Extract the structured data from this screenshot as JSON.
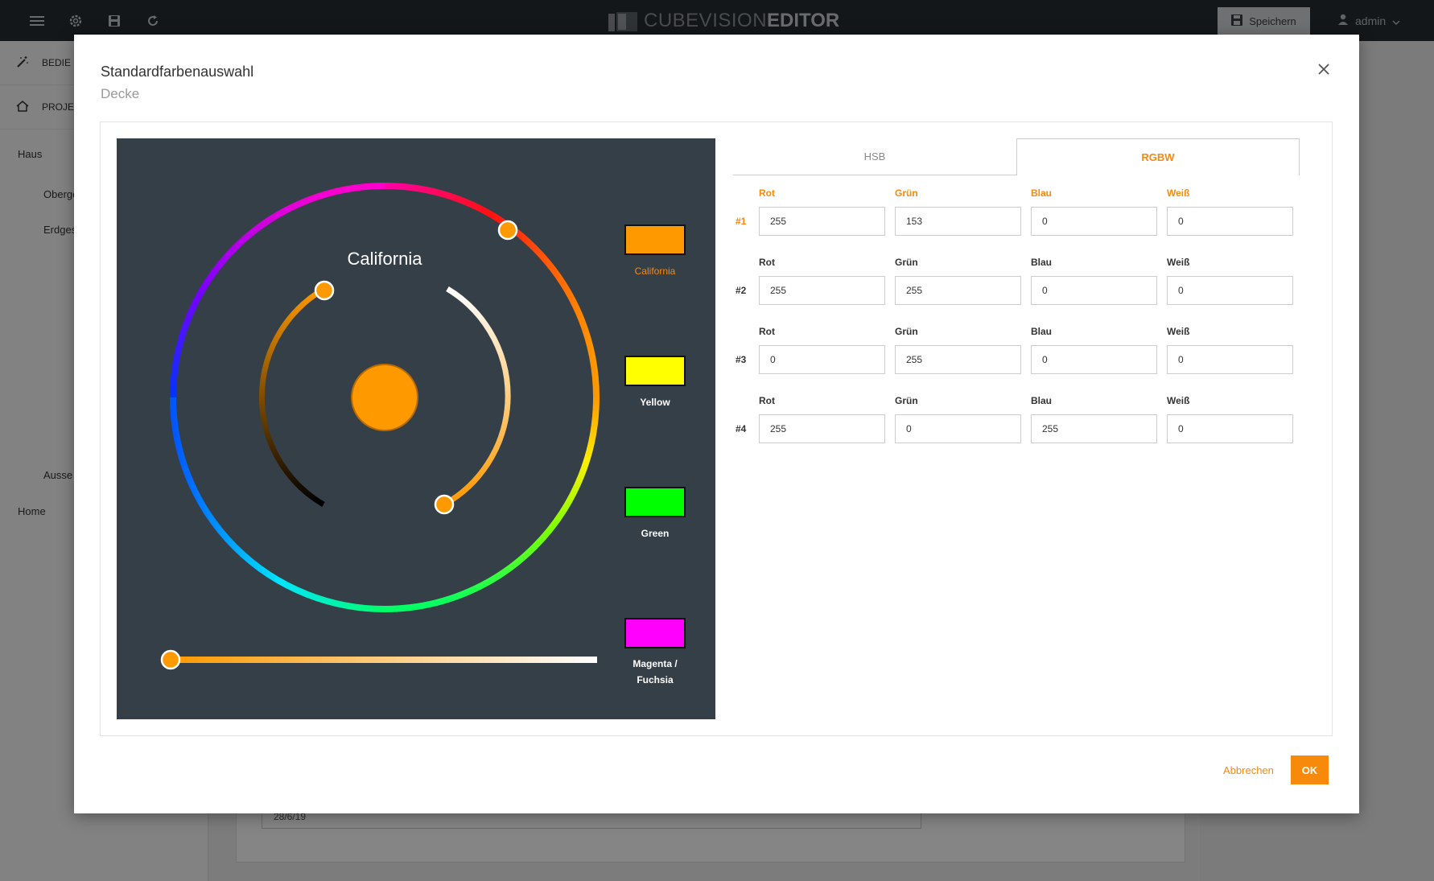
{
  "app": {
    "title_part1": "CUBEVISION",
    "title_part2": "EDITOR",
    "save_label": "Speichern",
    "user": "admin"
  },
  "sidebar": {
    "nav": [
      {
        "label": "BEDIE",
        "icon": "wand-icon"
      },
      {
        "label": "PROJE",
        "icon": "home-icon"
      }
    ],
    "tree": {
      "haus": "Haus",
      "oberg": "Oberge",
      "erdg": "Erdges",
      "aussen": "Ausse",
      "home": "Home"
    }
  },
  "background": {
    "date_value": "28/6/19"
  },
  "modal": {
    "title": "Standardfarbenauswahl",
    "subtitle": "Decke",
    "cancel_label": "Abbrechen",
    "ok_label": "OK"
  },
  "picker": {
    "current_name": "California",
    "current_color": "#ff9900",
    "presets": [
      {
        "name": "California",
        "color": "#ff9900",
        "active": true
      },
      {
        "name": "Yellow",
        "color": "#ffff00",
        "active": false
      },
      {
        "name": "Green",
        "color": "#00ff00",
        "active": false
      },
      {
        "name": "Magenta / Fuchsia",
        "name_line1": "Magenta /",
        "name_line2": "Fuchsia",
        "color": "#ff00ff",
        "active": false
      }
    ]
  },
  "tabs": [
    {
      "label": "HSB",
      "active": false
    },
    {
      "label": "RGBW",
      "active": true
    }
  ],
  "rgbw_rows": [
    {
      "label": "#1",
      "active": true,
      "fields": [
        {
          "label": "Rot",
          "value": "255"
        },
        {
          "label": "Grün",
          "value": "153"
        },
        {
          "label": "Blau",
          "value": "0"
        },
        {
          "label": "Weiß",
          "value": "0"
        }
      ]
    },
    {
      "label": "#2",
      "active": false,
      "fields": [
        {
          "label": "Rot",
          "value": "255"
        },
        {
          "label": "Grün",
          "value": "255"
        },
        {
          "label": "Blau",
          "value": "0"
        },
        {
          "label": "Weiß",
          "value": "0"
        }
      ]
    },
    {
      "label": "#3",
      "active": false,
      "fields": [
        {
          "label": "Rot",
          "value": "0"
        },
        {
          "label": "Grün",
          "value": "255"
        },
        {
          "label": "Blau",
          "value": "0"
        },
        {
          "label": "Weiß",
          "value": "0"
        }
      ]
    },
    {
      "label": "#4",
      "active": false,
      "fields": [
        {
          "label": "Rot",
          "value": "255"
        },
        {
          "label": "Grün",
          "value": "0"
        },
        {
          "label": "Blau",
          "value": "255"
        },
        {
          "label": "Weiß",
          "value": "0"
        }
      ]
    }
  ],
  "colors": {
    "accent": "#f7890b",
    "topbar": "#252c30",
    "picker_bg": "#353f47"
  }
}
